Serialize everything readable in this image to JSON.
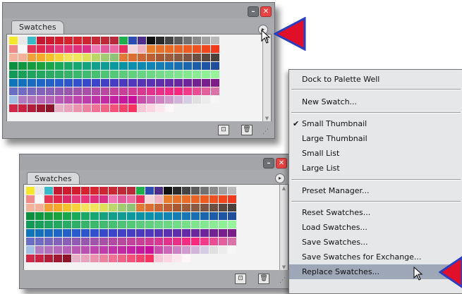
{
  "panel1": {
    "tab_label": "Swatches",
    "minimize_glyph": "–",
    "close_glyph": "✕",
    "menu_glyph": "▸"
  },
  "panel2": {
    "tab_label": "Swatches",
    "minimize_glyph": "–",
    "close_glyph": "✕",
    "menu_glyph": "▸"
  },
  "bottom_icons": {
    "new_swatch_glyph": "⊡",
    "delete_glyph": "🗑"
  },
  "swatch_rows": [
    [
      "#f5e82a",
      "#e9e9e9",
      "#3ab9c8",
      "#c41933",
      "#d01a2f",
      "#d21d2e",
      "#d6212f",
      "#d52631",
      "#cf2432",
      "#c82734",
      "#c02a38",
      "#b92a3c",
      "#1fae4c",
      "#2d4cb1",
      "#4c2d8b",
      "#111111",
      "#2a2a2a",
      "#444444",
      "#5b5b5b",
      "#727272",
      "#8a8a8a",
      "#a1a1a1",
      "#b9b9b9"
    ],
    [
      "#f08a8a",
      "#f7f7f7",
      "#e53454",
      "#e2274c",
      "#df2a6a",
      "#e33a7c",
      "#e9367b",
      "#e1307b",
      "#db2f8a",
      "#ee77b6",
      "#e4589d",
      "#ea6aa4",
      "#ec2f63",
      "#f3d6db",
      "#f2b3c0",
      "#e67d2c",
      "#e7712a",
      "#e86b28",
      "#ea6326",
      "#ed5b22",
      "#ef5020",
      "#f0461d",
      "#ef3a1e"
    ],
    [
      "#f4b39c",
      "#f3b19a",
      "#f39f3a",
      "#f6a92a",
      "#f7c12a",
      "#f8d33b",
      "#f6e25c",
      "#f2e55e",
      "#e0df59",
      "#bcd66b",
      "#a1cc72",
      "#8ec477",
      "#e07a34",
      "#dc6f34",
      "#cc6635",
      "#bf5f34",
      "#a85931",
      "#9c5b3a",
      "#8a5a43",
      "#7e5544",
      "#6c4f43",
      "#5b4840",
      "#4a3f3a"
    ],
    [
      "#0c8f3f",
      "#12963f",
      "#149c3e",
      "#1aa23e",
      "#1aa64b",
      "#1aa859",
      "#1aa866",
      "#17a672",
      "#15a37e",
      "#12a08a",
      "#0e9c94",
      "#0c989d",
      "#0a93a5",
      "#0b8fab",
      "#0d8ab0",
      "#1184b3",
      "#147db4",
      "#1776b4",
      "#186eb1",
      "#1b65ad",
      "#1d5ca8",
      "#1f54a2",
      "#1f4c9b"
    ],
    [
      "#129b58",
      "#18a05b",
      "#1ea45e",
      "#24a861",
      "#2aac64",
      "#30b067",
      "#36b46a",
      "#3cb86d",
      "#42bc70",
      "#48c073",
      "#4ec476",
      "#54c879",
      "#5acc7c",
      "#60d07f",
      "#66d482",
      "#6cd885",
      "#72dc88",
      "#78e08b",
      "#7ee48e",
      "#84e891",
      "#8aec94",
      "#90f097",
      "#96f49a"
    ],
    [
      "#0f74b8",
      "#1470bd",
      "#196bc2",
      "#1e66c6",
      "#2361c9",
      "#285bcb",
      "#2d55cc",
      "#324fcc",
      "#3749cb",
      "#3c44c9",
      "#4140c6",
      "#463dc3",
      "#4b3abf",
      "#5037bb",
      "#5534b6",
      "#5a31b1",
      "#5f2eac",
      "#642ba6",
      "#6928a0",
      "#6e259a",
      "#732294",
      "#781f8e",
      "#7d1c88"
    ],
    [
      "#6a6fc6",
      "#726bc3",
      "#7a67bf",
      "#8263bc",
      "#8a5fb8",
      "#925bb4",
      "#9a57b0",
      "#a253ac",
      "#aa4fa8",
      "#b24ba4",
      "#ba47a0",
      "#c2439c",
      "#ca3f98",
      "#d23b94",
      "#da3790",
      "#e2338c",
      "#ea2f88",
      "#f22b84",
      "#fa2780",
      "#f23a8a",
      "#ea4d94",
      "#e2609e",
      "#da73a8"
    ],
    [
      "#a3bfe3",
      "#b07bc0",
      "#b272bd",
      "#b469ba",
      "#b660b7",
      "#b857b4",
      "#ba4eb1",
      "#bc45ae",
      "#be3cab",
      "#c033a8",
      "#c22aa5",
      "#c421a2",
      "#c6189f",
      "#c80f9c",
      "#ca4daa",
      "#cc66b6",
      "#ce80c2",
      "#d09acd",
      "#d2b3d9",
      "#d4cde4",
      "#e0e0e0",
      "#ececec",
      "#f6f6f6"
    ],
    [
      "#d1284a",
      "#c92242",
      "#b41d3a",
      "#9f1932",
      "#8c152a",
      "#e7b2c8",
      "#e9a2bb",
      "#eb92ae",
      "#ed82a1",
      "#ef7294",
      "#f16287",
      "#f3527a",
      "#f5426d",
      "#f73260",
      "#f9c6d6",
      "#fbd6e2",
      "#fde6ee",
      "#fff6fa",
      "#f3f3f3",
      "#f3f3f3",
      "#f3f3f3",
      "#f3f3f3",
      "#f3f3f3"
    ]
  ],
  "menu": {
    "items": [
      {
        "label": "Dock to Palette Well",
        "checked": false
      },
      {
        "label": "New Swatch...",
        "checked": false
      },
      {
        "label": "Small Thumbnail",
        "checked": true
      },
      {
        "label": "Large Thumbnail",
        "checked": false
      },
      {
        "label": "Small List",
        "checked": false
      },
      {
        "label": "Large List",
        "checked": false
      },
      {
        "label": "Preset Manager...",
        "checked": false
      },
      {
        "label": "Reset Swatches...",
        "checked": false
      },
      {
        "label": "Load Swatches...",
        "checked": false
      },
      {
        "label": "Save Swatches...",
        "checked": false
      },
      {
        "label": "Save Swatches for Exchange...",
        "checked": false
      },
      {
        "label": "Replace Swatches...",
        "checked": false,
        "highlighted": true
      }
    ],
    "check_glyph": "✔"
  },
  "colors": {
    "pointer_red": "#e0102a",
    "pointer_blue": "#2a3fc0",
    "menu_highlight": "#9da7b8"
  }
}
